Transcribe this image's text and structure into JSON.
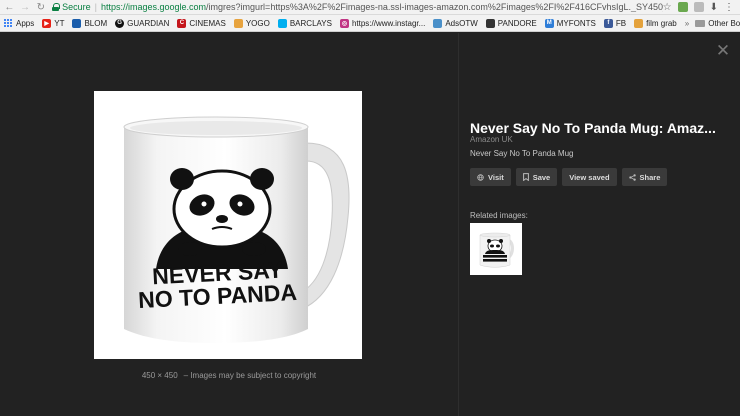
{
  "browser": {
    "secure_label": "Secure",
    "url_host": "https://images.google.com",
    "url_path": "/imgres?imgurl=https%3A%2F%2Fimages-na.ssl-images-amazon.com%2Fimages%2FI%2F416CFvhsIgL._SY450_..."
  },
  "bookmarks": {
    "items": [
      {
        "label": "Apps",
        "icon": "apps-grid-icon"
      },
      {
        "label": "YT",
        "icon": "youtube-icon",
        "color": "#e62117"
      },
      {
        "label": "BLOM",
        "icon": "blom-icon",
        "color": "#1a5dab"
      },
      {
        "label": "GUARDIAN",
        "icon": "guardian-icon",
        "color": "#111111"
      },
      {
        "label": "CINEMAS",
        "icon": "cinemas-icon",
        "color": "#c4161c"
      },
      {
        "label": "YOGO",
        "icon": "yogo-icon",
        "color": "#e7a33e"
      },
      {
        "label": "BARCLAYS",
        "icon": "barclays-icon",
        "color": "#00aeef"
      },
      {
        "label": "https://www.instagr...",
        "icon": "instagram-icon",
        "color": "#c13584"
      },
      {
        "label": "AdsOTW",
        "icon": "adsotw-icon",
        "color": "#4a90c9"
      },
      {
        "label": "PANDORE",
        "icon": "pandore-icon",
        "color": "#333333"
      },
      {
        "label": "MYFONTS",
        "icon": "myfonts-icon",
        "color": "#2f7ed8"
      },
      {
        "label": "FB",
        "icon": "facebook-icon",
        "color": "#3b5998"
      },
      {
        "label": "film grab",
        "icon": "film-grab-icon",
        "color": "#e4a23c"
      }
    ],
    "overflow": "»",
    "other_label": "Other Bookmarks"
  },
  "viewer": {
    "image_dimensions": "450 × 450",
    "copyright_note": "Images may be subject to copyright",
    "title": "Never Say No To Panda Mug: Amaz...",
    "source": "Amazon UK",
    "description": "Never Say No To Panda Mug",
    "buttons": {
      "visit": "Visit",
      "save": "Save",
      "view_saved": "View saved",
      "share": "Share"
    },
    "related_label": "Related images:",
    "mug_text_line1": "NEVER SAY",
    "mug_text_line2": "NO TO PANDA",
    "close_icon": "close-icon"
  }
}
